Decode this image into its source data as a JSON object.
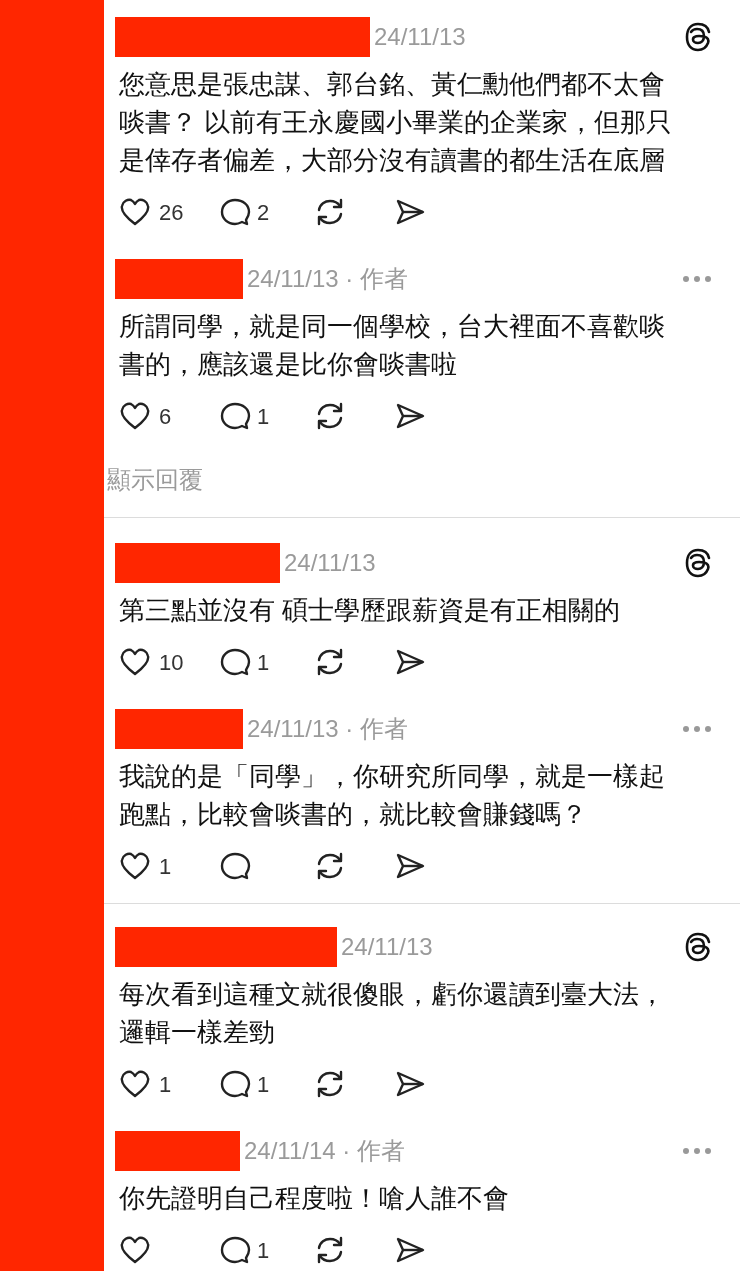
{
  "threads": [
    {
      "posts": [
        {
          "name_redacted": true,
          "meta": "24/11/13",
          "kind": "comment",
          "text": "您意思是張忠謀、郭台銘、黃仁勳他們都不太會啖書？ 以前有王永慶國小畢業的企業家，但那只是倖存者偏差，大部分沒有讀書的都生活在底層",
          "likes": "26",
          "replies": "2"
        },
        {
          "name_redacted": true,
          "meta": "24/11/13 · 作者",
          "kind": "author_reply",
          "text": "所謂同學，就是同一個學校，台大裡面不喜歡啖書的，應該還是比你會啖書啦",
          "likes": "6",
          "replies": "1"
        }
      ],
      "show_replies": "顯示回覆"
    },
    {
      "posts": [
        {
          "name_redacted": true,
          "meta": "24/11/13",
          "kind": "comment",
          "text": "第三點並沒有 碩士學歷跟薪資是有正相關的",
          "likes": "10",
          "replies": "1"
        },
        {
          "name_redacted": true,
          "meta": "24/11/13 · 作者",
          "kind": "author_reply",
          "text": "我說的是「同學」，你研究所同學，就是一樣起跑點，比較會啖書的，就比較會賺錢嗎？",
          "likes": "1"
        }
      ]
    },
    {
      "posts": [
        {
          "name_redacted": true,
          "meta": "24/11/13",
          "kind": "comment",
          "text": "每次看到這種文就很傻眼，虧你還讀到臺大法，邏輯一樣差勁",
          "likes": "1",
          "replies": "1"
        },
        {
          "name_redacted": true,
          "meta": "24/11/14 · 作者",
          "kind": "author_reply",
          "text": "你先證明自己程度啦！嗆人誰不會",
          "replies": "1"
        }
      ]
    }
  ]
}
